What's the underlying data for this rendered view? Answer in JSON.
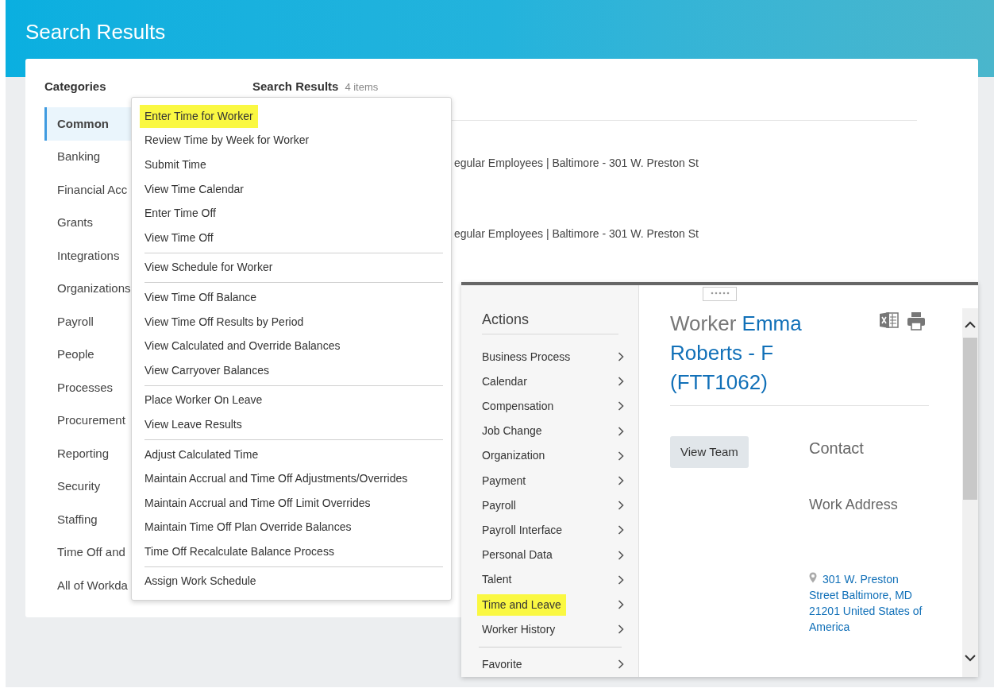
{
  "header": {
    "title": "Search Results"
  },
  "categories": {
    "title": "Categories",
    "items": [
      {
        "label": "Common",
        "selected": true
      },
      {
        "label": "Banking",
        "selected": false
      },
      {
        "label": "Financial Acc",
        "selected": false
      },
      {
        "label": "Grants",
        "selected": false
      },
      {
        "label": "Integrations",
        "selected": false
      },
      {
        "label": "Organizations",
        "selected": false
      },
      {
        "label": "Payroll",
        "selected": false
      },
      {
        "label": "People",
        "selected": false
      },
      {
        "label": "Processes",
        "selected": false
      },
      {
        "label": "Procurement",
        "selected": false
      },
      {
        "label": "Reporting",
        "selected": false
      },
      {
        "label": "Security",
        "selected": false
      },
      {
        "label": "Staffing",
        "selected": false
      },
      {
        "label": "Time Off and",
        "selected": false
      },
      {
        "label": "All of Workda",
        "selected": false
      }
    ]
  },
  "results": {
    "title": "Search Results",
    "count": "4 items",
    "rows": [
      "egular Employees | Baltimore - 301 W. Preston St",
      "egular Employees | Baltimore - 301 W. Preston St"
    ]
  },
  "menu": {
    "groups": [
      [
        {
          "label": "Enter Time for Worker",
          "highlighted": true
        },
        {
          "label": "Review Time by Week for Worker",
          "highlighted": false
        },
        {
          "label": "Submit Time",
          "highlighted": false
        },
        {
          "label": "View Time Calendar",
          "highlighted": false
        },
        {
          "label": "Enter Time Off",
          "highlighted": false
        },
        {
          "label": "View Time Off",
          "highlighted": false
        }
      ],
      [
        {
          "label": "View Schedule for Worker",
          "highlighted": false
        }
      ],
      [
        {
          "label": "View Time Off Balance",
          "highlighted": false
        },
        {
          "label": "View Time Off Results by Period",
          "highlighted": false
        },
        {
          "label": "View Calculated and Override Balances",
          "highlighted": false
        },
        {
          "label": "View Carryover Balances",
          "highlighted": false
        }
      ],
      [
        {
          "label": "Place Worker On Leave",
          "highlighted": false
        },
        {
          "label": "View Leave Results",
          "highlighted": false
        }
      ],
      [
        {
          "label": "Adjust Calculated Time",
          "highlighted": false
        },
        {
          "label": "Maintain Accrual and Time Off Adjustments/Overrides",
          "highlighted": false
        },
        {
          "label": "Maintain Accrual and Time Off Limit Overrides",
          "highlighted": false
        },
        {
          "label": "Maintain Time Off Plan Override Balances",
          "highlighted": false
        },
        {
          "label": "Time Off Recalculate Balance Process",
          "highlighted": false
        }
      ],
      [
        {
          "label": "Assign Work Schedule",
          "highlighted": false
        }
      ]
    ]
  },
  "actions_popup": {
    "title": "Actions",
    "items": [
      {
        "label": "Business Process",
        "highlighted": false
      },
      {
        "label": "Calendar",
        "highlighted": false
      },
      {
        "label": "Compensation",
        "highlighted": false
      },
      {
        "label": "Job Change",
        "highlighted": false
      },
      {
        "label": "Organization",
        "highlighted": false
      },
      {
        "label": "Payment",
        "highlighted": false
      },
      {
        "label": "Payroll",
        "highlighted": false
      },
      {
        "label": "Payroll Interface",
        "highlighted": false
      },
      {
        "label": "Personal Data",
        "highlighted": false
      },
      {
        "label": "Talent",
        "highlighted": false
      },
      {
        "label": "Time and Leave",
        "highlighted": true
      },
      {
        "label": "Worker History",
        "highlighted": false
      }
    ],
    "footer_items": [
      {
        "label": "Favorite",
        "highlighted": false
      }
    ],
    "worker": {
      "prefix": "Worker",
      "name": "Emma Roberts - F (FTT1062)"
    },
    "button": "View Team",
    "contact_title": "Contact",
    "address_title": "Work Address",
    "address": "301 W. Preston Street Baltimore, MD 21201 United States of America"
  }
}
